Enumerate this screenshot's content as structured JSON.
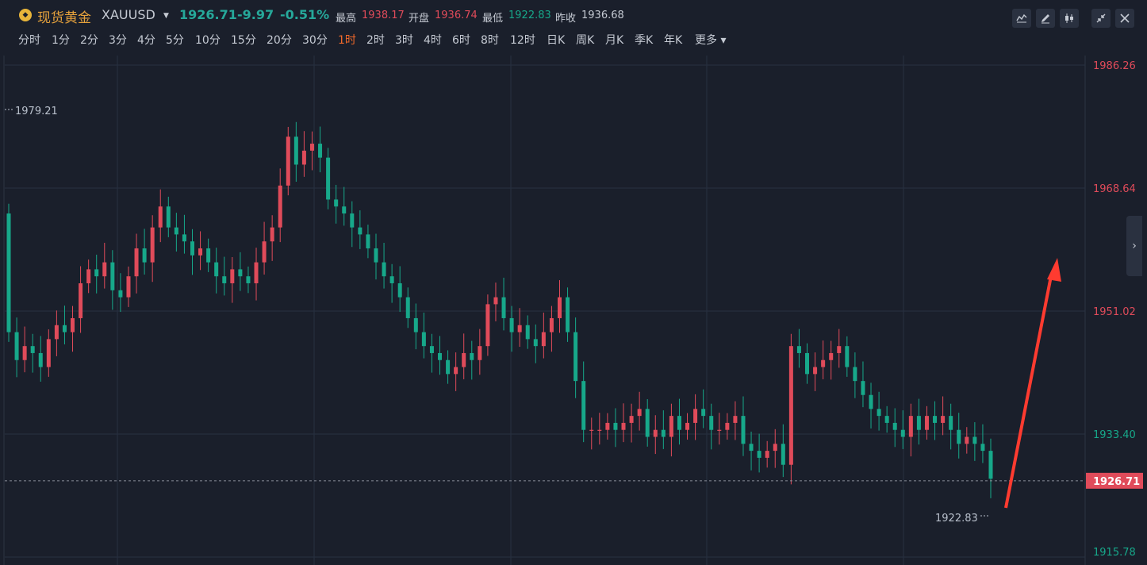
{
  "header": {
    "symbol_cn": "现货黄金",
    "symbol_code": "XAUUSD",
    "last": "1926.71",
    "change": "-9.97",
    "change_pct": "-0.51%",
    "high_label": "最高",
    "high": "1938.17",
    "open_label": "开盘",
    "open": "1936.74",
    "low_label": "最低",
    "low": "1922.83",
    "prev_close_label": "昨收",
    "prev_close": "1936.68"
  },
  "intervals": [
    "分时",
    "1分",
    "2分",
    "3分",
    "4分",
    "5分",
    "10分",
    "15分",
    "20分",
    "30分",
    "1时",
    "2时",
    "3时",
    "4时",
    "6时",
    "8时",
    "12时",
    "日K",
    "周K",
    "月K",
    "季K",
    "年K",
    "更多"
  ],
  "active_interval": "1时",
  "toolbar": [
    "indicator-icon",
    "draw-icon",
    "candle-type-icon",
    "shrink-icon",
    "close-icon"
  ],
  "colors": {
    "up": "#e04b5a",
    "down": "#17a88a",
    "bg": "#1a1f2b",
    "grid": "#283140",
    "accent": "#f0692b",
    "arrow": "#ff3b30"
  },
  "chart_data": {
    "type": "candlestick",
    "y_axis": {
      "ticks": [
        1986.26,
        1968.64,
        1951.02,
        1933.4,
        1915.78
      ],
      "tick_labels": [
        "1986.26",
        "1968.64",
        "1951.02",
        "1933.40",
        "1915.78"
      ]
    },
    "last_price": 1926.71,
    "last_price_label": "1926.71",
    "max_marker": {
      "value": 1979.21,
      "label": "1979.21"
    },
    "min_marker": {
      "value": 1922.83,
      "label": "1922.83"
    },
    "annotation": "red upward arrow (hand-drawn)",
    "close_series": [
      1948,
      1944,
      1946,
      1945,
      1943,
      1947,
      1949,
      1948,
      1950,
      1955,
      1957,
      1956,
      1958,
      1954,
      1953,
      1956,
      1960,
      1958,
      1963,
      1966,
      1963,
      1962,
      1961,
      1959,
      1960,
      1958,
      1956,
      1955,
      1957,
      1956,
      1955,
      1958,
      1961,
      1963,
      1969,
      1976,
      1972,
      1974,
      1975,
      1973,
      1967,
      1966,
      1965,
      1963,
      1962,
      1960,
      1958,
      1956,
      1955,
      1953,
      1950,
      1948,
      1946,
      1945,
      1944,
      1942,
      1943,
      1945,
      1944,
      1946,
      1952,
      1953,
      1950,
      1948,
      1949,
      1947,
      1946,
      1948,
      1950,
      1953,
      1948,
      1941,
      1934,
      1934,
      1934,
      1935,
      1934,
      1935,
      1936,
      1937,
      1933,
      1934,
      1933,
      1936,
      1934,
      1935,
      1937,
      1936,
      1934,
      1934,
      1935,
      1936,
      1932,
      1931,
      1930,
      1931,
      1932,
      1929,
      1946,
      1945,
      1942,
      1943,
      1944,
      1945,
      1946,
      1943,
      1941,
      1939,
      1937,
      1936,
      1935,
      1934,
      1933,
      1936,
      1934,
      1936,
      1935,
      1936,
      1934,
      1932,
      1933,
      1932,
      1931,
      1927
    ]
  }
}
